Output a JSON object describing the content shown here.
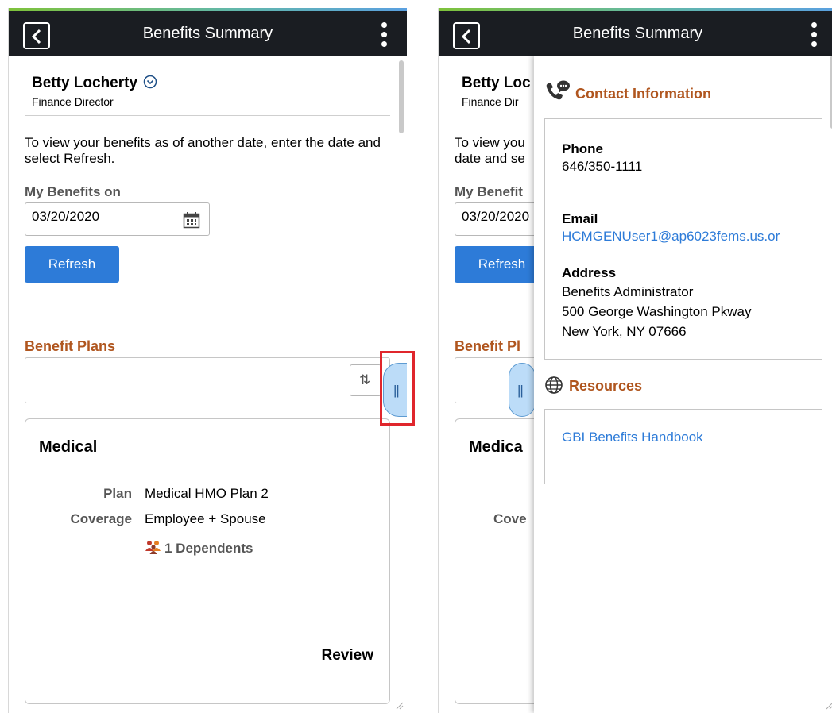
{
  "header": {
    "title": "Benefits Summary"
  },
  "employee": {
    "name": "Betty Locherty",
    "job_title": "Finance Director"
  },
  "intro_text": "To view your benefits as of another date, enter the date and select Refresh.",
  "date_filter": {
    "label": "My Benefits on",
    "value": "03/20/2020",
    "refresh_label": "Refresh"
  },
  "benefit_plans": {
    "title": "Benefit Plans",
    "sort_icon": "sort-arrows-icon"
  },
  "medical_card": {
    "title": "Medical",
    "plan_label": "Plan",
    "plan_value": "Medical HMO Plan 2",
    "coverage_label": "Coverage",
    "coverage_value": "Employee + Spouse",
    "dependents": "1 Dependents",
    "review_label": "Review"
  },
  "right_view": {
    "truncated": {
      "name": "Betty Loc",
      "job_title": "Finance Dir",
      "intro": "To view you date and se",
      "date_label": "My Benefit",
      "date_value": "03/20/2020",
      "refresh_label": "Refresh",
      "section_title": "Benefit Pl",
      "card_title": "Medica",
      "coverage_label": "Cove"
    },
    "contact": {
      "title": "Contact Information",
      "phone_label": "Phone",
      "phone": "646/350-1111",
      "email_label": "Email",
      "email": "HCMGENUser1@ap6023fems.us.or",
      "address_label": "Address",
      "address_line1": "Benefits Administrator",
      "address_line2": "500 George Washington Pkway",
      "address_line3": "New York, NY 07666"
    },
    "resources": {
      "title": "Resources",
      "handbook_link": "GBI Benefits Handbook"
    }
  },
  "handle_glyph": "||",
  "colors": {
    "section_title": "#b0561f",
    "primary_button": "#2d7bd8",
    "topbar": "#1a1d22",
    "callout": "#e0262c"
  }
}
